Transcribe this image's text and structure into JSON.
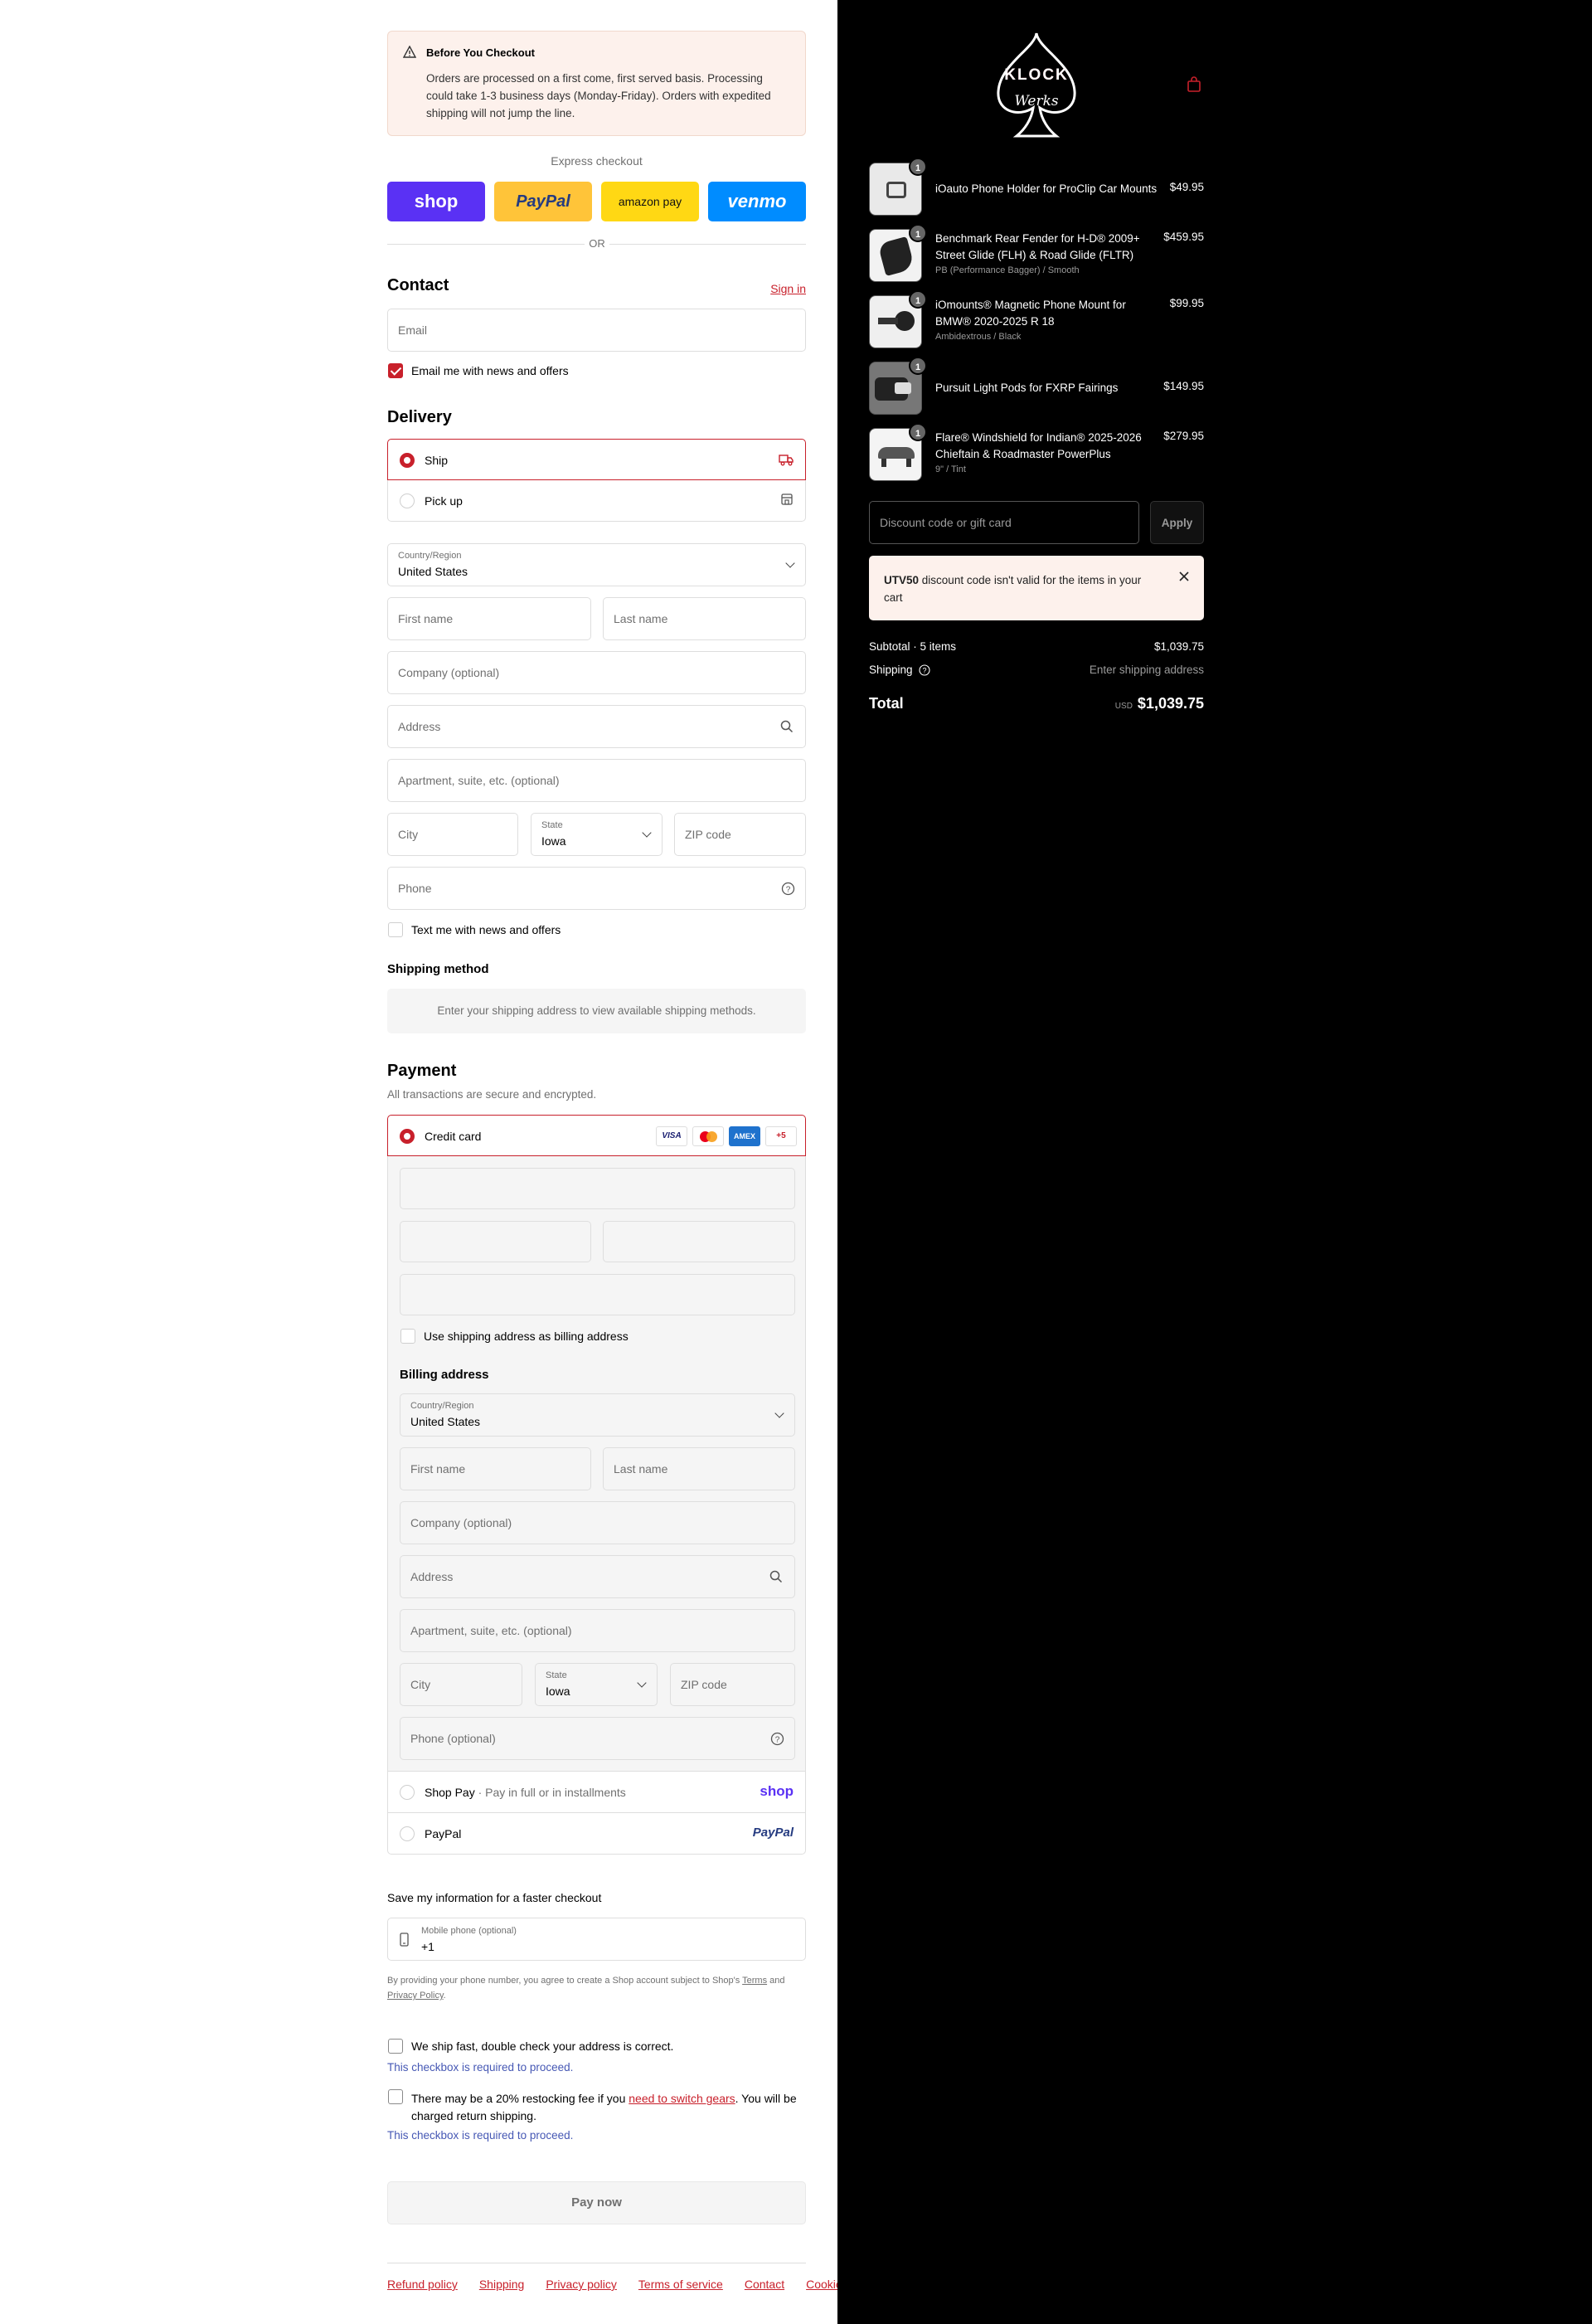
{
  "notice": {
    "title": "Before You Checkout",
    "body": "Orders are processed on a first come, first served basis. Processing could take 1-3 business days (Monday-Friday). Orders with expedited shipping will not jump the line."
  },
  "express": {
    "label": "Express checkout",
    "shop": "shop",
    "paypal": "PayPal",
    "amazon": "amazon pay",
    "venmo": "venmo",
    "or": "OR"
  },
  "contact": {
    "heading": "Contact",
    "sign_in": "Sign in",
    "email_placeholder": "Email",
    "news_label": "Email me with news and offers"
  },
  "delivery": {
    "heading": "Delivery",
    "ship": "Ship",
    "pickup": "Pick up",
    "country_label": "Country/Region",
    "country": "United States",
    "first": "First name",
    "last": "Last name",
    "company": "Company (optional)",
    "address": "Address",
    "apt": "Apartment, suite, etc. (optional)",
    "city": "City",
    "state_label": "State",
    "state": "Iowa",
    "zip": "ZIP code",
    "phone": "Phone",
    "text_label": "Text me with news and offers"
  },
  "shipping_method": {
    "heading": "Shipping method",
    "message": "Enter your shipping address to view available shipping methods."
  },
  "payment": {
    "heading": "Payment",
    "sub": "All transactions are secure and encrypted.",
    "credit": "Credit card",
    "more_cards": "+5",
    "visa": "VISA",
    "amex": "AMEX",
    "use_shipping": "Use shipping address as billing address",
    "billing_heading": "Billing address",
    "country_label": "Country/Region",
    "country": "United States",
    "first": "First name",
    "last": "Last name",
    "company": "Company (optional)",
    "address": "Address",
    "apt": "Apartment, suite, etc. (optional)",
    "city": "City",
    "state_label": "State",
    "state": "Iowa",
    "zip": "ZIP code",
    "phone": "Phone (optional)",
    "shoppay": "Shop Pay",
    "shoppay_sub": "Pay in full or in installments",
    "shoppay_logo": "shop",
    "paypal": "PayPal",
    "paypal_logo": "PayPal"
  },
  "save": {
    "heading": "Save my information for a faster checkout",
    "mobile_label": "Mobile phone (optional)",
    "mobile_value": "+1",
    "disclaimer_pre": "By providing your phone number, you agree to create a Shop account subject to Shop's",
    "terms": "Terms",
    "and": "and",
    "privacy": "Privacy Policy",
    "period": "."
  },
  "checks": {
    "c1": "We ship fast, double check your address is correct.",
    "c1_req": "This checkbox is required to proceed.",
    "c2_pre": "There may be a 20% restocking fee if you",
    "c2_link": "need to switch gears",
    "c2_post": ". You will be charged return shipping.",
    "c2_req": "This checkbox is required to proceed."
  },
  "pay_now": "Pay now",
  "footer": [
    "Refund policy",
    "Shipping",
    "Privacy policy",
    "Terms of service",
    "Contact",
    "Cookies"
  ],
  "brand": {
    "logo_letters": "KLOCK",
    "logo_script": "Werks"
  },
  "items": [
    {
      "qty": "1",
      "name": "iOauto Phone Holder for ProClip Car Mounts",
      "variant": "",
      "price": "$49.95"
    },
    {
      "qty": "1",
      "name": "Benchmark Rear Fender for H-D® 2009+ Street Glide (FLH) & Road Glide (FLTR)",
      "variant": "PB (Performance Bagger) / Smooth",
      "price": "$459.95"
    },
    {
      "qty": "1",
      "name": "iOmounts® Magnetic Phone Mount for BMW® 2020-2025 R 18",
      "variant": "Ambidextrous / Black",
      "price": "$99.95"
    },
    {
      "qty": "1",
      "name": "Pursuit Light Pods for FXRP Fairings",
      "variant": "",
      "price": "$149.95"
    },
    {
      "qty": "1",
      "name": "Flare® Windshield for Indian® 2025-2026 Chieftain & Roadmaster PowerPlus",
      "variant": "9\" / Tint",
      "price": "$279.95"
    }
  ],
  "discount": {
    "placeholder": "Discount code or gift card",
    "apply": "Apply",
    "error_code": "UTV50",
    "error_msg": "discount code isn't valid for the items in your cart"
  },
  "totals": {
    "subtotal_label": "Subtotal · 5 items",
    "subtotal": "$1,039.75",
    "shipping_label": "Shipping",
    "shipping": "Enter shipping address",
    "total_label": "Total",
    "currency": "USD",
    "total": "$1,039.75"
  },
  "colors": {
    "accent": "#c8202b",
    "shop": "#5a31f4",
    "paypal_btn": "#ffc439",
    "amazon_btn": "#ffd814",
    "venmo": "#008cff",
    "notice_bg": "#fdf1ec"
  }
}
